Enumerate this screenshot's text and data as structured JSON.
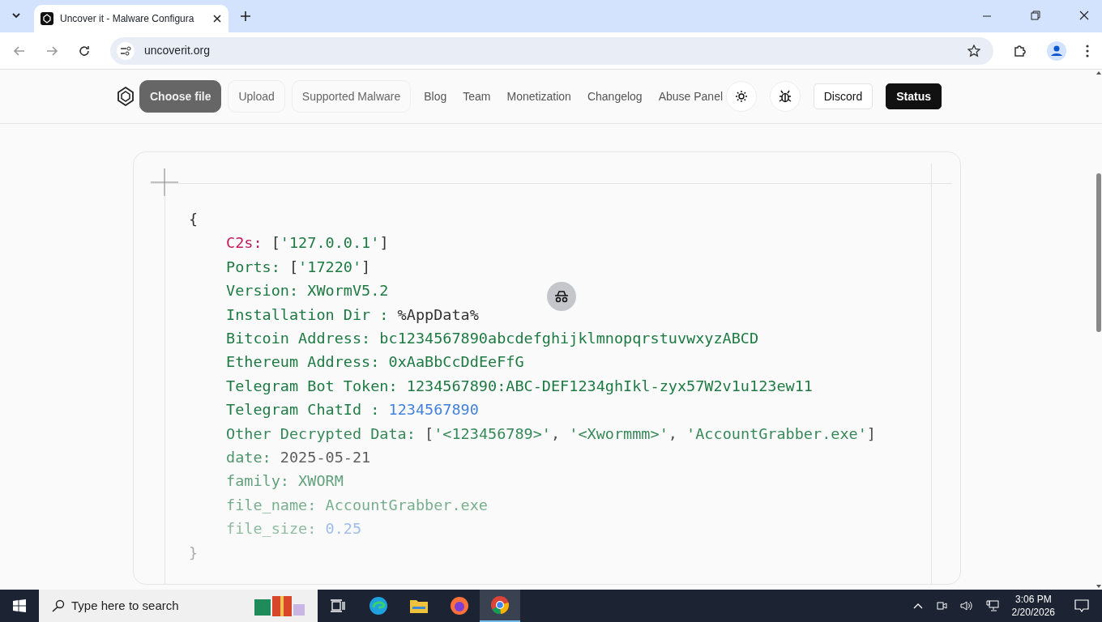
{
  "browser": {
    "tab_title": "Uncover it - Malware Configura",
    "url": "uncoverit.org"
  },
  "nav": {
    "links": [
      "Blog",
      "Team",
      "Monetization",
      "Changelog",
      "Abuse Panel"
    ],
    "floating_buttons": [
      {
        "label": "Choose file",
        "kind": "primary"
      },
      {
        "label": "Upload",
        "kind": "ghost"
      },
      {
        "label": "Supported Malware",
        "kind": "ghost"
      }
    ],
    "actions": [
      {
        "label": "Discord",
        "kind": "outline"
      },
      {
        "label": "Status",
        "kind": "dark"
      }
    ]
  },
  "config": {
    "open_brace": "{",
    "close_brace": "}",
    "lines": [
      {
        "key": "C2s:",
        "highlighted": true,
        "parts": [
          {
            "text": " [",
            "kind": "punct"
          },
          {
            "text": "'127.0.0.1'",
            "kind": "string"
          },
          {
            "text": "]",
            "kind": "punct"
          }
        ]
      },
      {
        "key": "Ports:",
        "highlighted": false,
        "parts": [
          {
            "text": " [",
            "kind": "punct"
          },
          {
            "text": "'17220'",
            "kind": "string"
          },
          {
            "text": "]",
            "kind": "punct"
          }
        ]
      },
      {
        "key": "Version:",
        "highlighted": false,
        "parts": [
          {
            "text": " XWormV5.2",
            "kind": "string"
          }
        ]
      },
      {
        "key": "Installation Dir :",
        "highlighted": false,
        "parts": [
          {
            "text": " %AppData%",
            "kind": "punct"
          }
        ]
      },
      {
        "key": "Bitcoin Address:",
        "highlighted": false,
        "parts": [
          {
            "text": " bc1234567890abcdefghijklmnopqrstuvwxyzABCD",
            "kind": "string"
          }
        ]
      },
      {
        "key": "Ethereum Address:",
        "highlighted": false,
        "parts": [
          {
            "text": " 0xAaBbCcDdEeFfG",
            "kind": "string"
          }
        ]
      },
      {
        "key": "Telegram Bot Token:",
        "highlighted": false,
        "parts": [
          {
            "text": " 1234567890:ABC-DEF1234ghIkl-zyx57W2v1u123ew11",
            "kind": "string"
          }
        ]
      },
      {
        "key": "Telegram ChatId :",
        "highlighted": false,
        "parts": [
          {
            "text": " 1234567890",
            "kind": "number"
          }
        ]
      },
      {
        "key": "Other Decrypted Data:",
        "highlighted": false,
        "parts": [
          {
            "text": " [",
            "kind": "punct"
          },
          {
            "text": "'<123456789>'",
            "kind": "string"
          },
          {
            "text": ", ",
            "kind": "punct"
          },
          {
            "text": "'<Xwormmm>'",
            "kind": "string"
          },
          {
            "text": ", ",
            "kind": "punct"
          },
          {
            "text": "'AccountGrabber.exe'",
            "kind": "string"
          },
          {
            "text": "]",
            "kind": "punct"
          }
        ]
      },
      {
        "key": "date:",
        "highlighted": false,
        "parts": [
          {
            "text": " 2025-05-21",
            "kind": "punct"
          }
        ]
      },
      {
        "key": "family:",
        "highlighted": false,
        "parts": [
          {
            "text": " XWORM",
            "kind": "string"
          }
        ]
      },
      {
        "key": "file_name:",
        "highlighted": false,
        "parts": [
          {
            "text": " AccountGrabber.exe",
            "kind": "string"
          }
        ]
      },
      {
        "key": "file_size:",
        "highlighted": false,
        "parts": [
          {
            "text": " 0.25",
            "kind": "number"
          }
        ]
      }
    ]
  },
  "taskbar": {
    "search_placeholder": "Type here to search",
    "time": "3:06 PM",
    "date": "2/20/2026"
  }
}
